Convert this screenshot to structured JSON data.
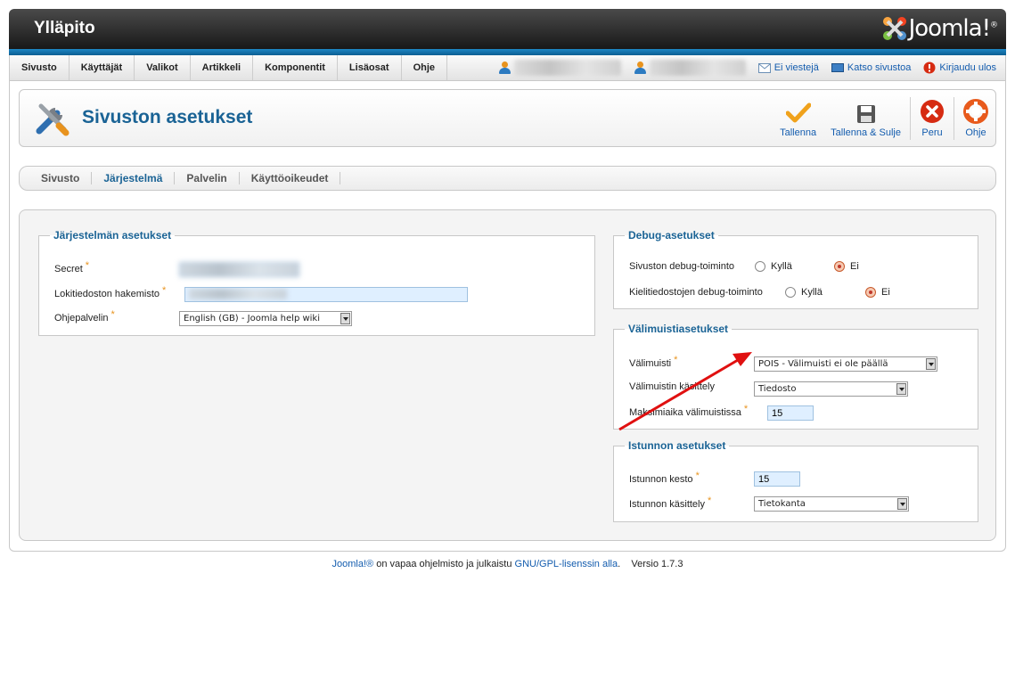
{
  "header": {
    "site_title": "Ylläpito",
    "logo_text": "Joomla!",
    "logo_mark": "®"
  },
  "menu": {
    "items": [
      "Sivusto",
      "Käyttäjät",
      "Valikot",
      "Artikkeli",
      "Komponentit",
      "Lisäosat",
      "Ohje"
    ]
  },
  "status": {
    "messages": "Ei viestejä",
    "view_site": "Katso sivustoa",
    "logout": "Kirjaudu ulos"
  },
  "toolbar": {
    "page_title": "Sivuston asetukset",
    "save": "Tallenna",
    "save_close": "Tallenna & Sulje",
    "cancel": "Peru",
    "help": "Ohje"
  },
  "subtabs": [
    "Sivusto",
    "Järjestelmä",
    "Palvelin",
    "Käyttöoikeudet"
  ],
  "system": {
    "legend": "Järjestelmän asetukset",
    "secret_label": "Secret",
    "log_label": "Lokitiedoston hakemisto",
    "help_label": "Ohjepalvelin",
    "help_value": "English (GB) - Joomla help wiki"
  },
  "debug": {
    "legend": "Debug-asetukset",
    "site_debug_label": "Sivuston debug-toiminto",
    "lang_debug_label": "Kielitiedostojen debug-toiminto",
    "yes": "Kyllä",
    "no": "Ei"
  },
  "cache": {
    "legend": "Välimuistiasetukset",
    "cache_label": "Välimuisti",
    "cache_value": "POIS - Välimuisti ei ole päällä",
    "handler_label": "Välimuistin käsittely",
    "handler_value": "Tiedosto",
    "time_label": "Maksimiaika välimuistissa",
    "time_value": "15"
  },
  "session": {
    "legend": "Istunnon asetukset",
    "lifetime_label": "Istunnon kesto",
    "lifetime_value": "15",
    "handler_label": "Istunnon käsittely",
    "handler_value": "Tietokanta"
  },
  "footer": {
    "joomla_link": "Joomla!®",
    "text1": " on vapaa ohjelmisto ja julkaistu ",
    "license_link": "GNU/GPL-lisenssin alla",
    "text2": ".",
    "version": "Versio 1.7.3"
  },
  "required_mark": "*",
  "colors": {
    "accent": "#1a6395",
    "link": "#135cae",
    "required": "#e8931e",
    "annotation_arrow": "#e01010"
  }
}
